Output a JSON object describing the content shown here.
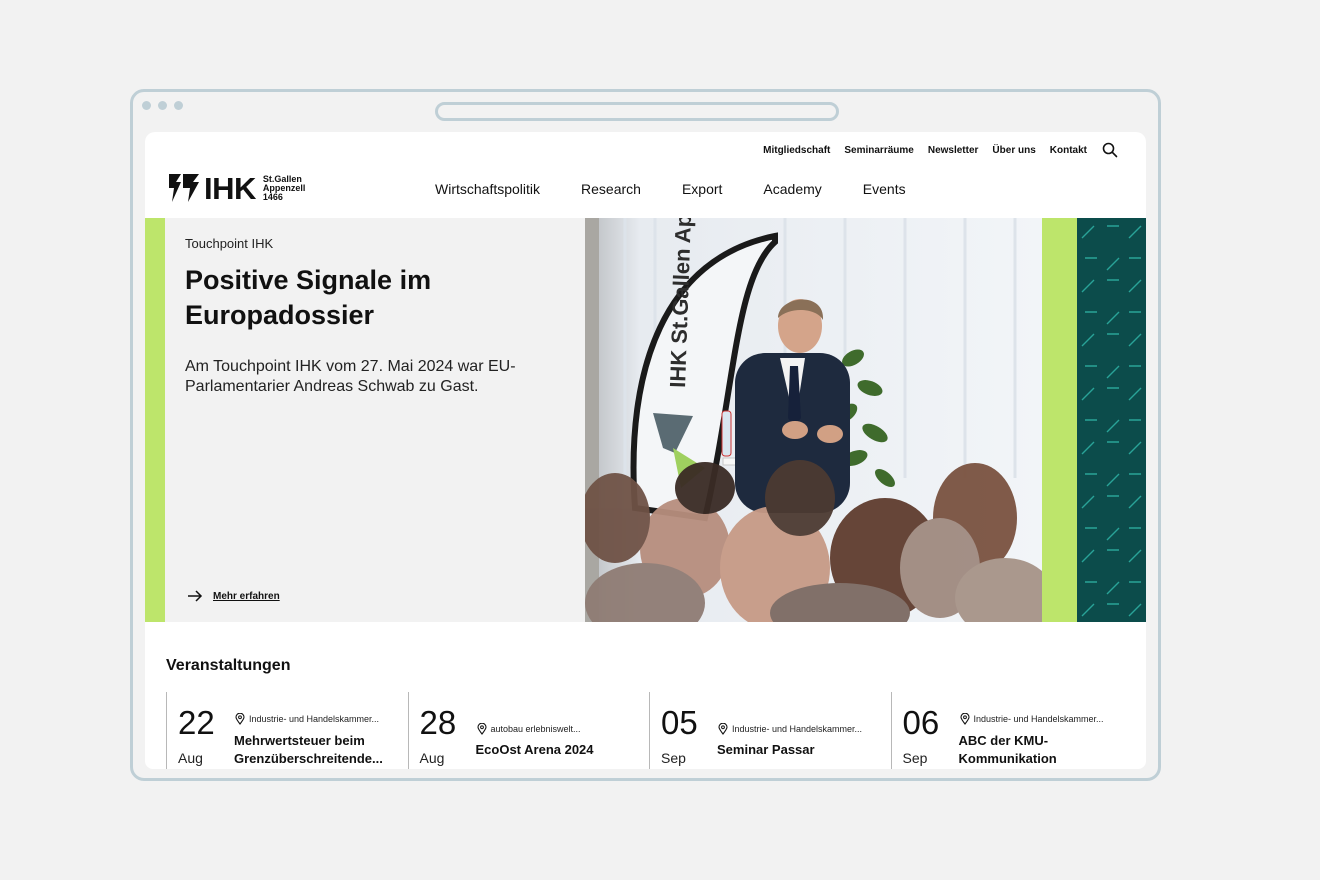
{
  "utility_nav": [
    "Mitgliedschaft",
    "Seminarräume",
    "Newsletter",
    "Über uns",
    "Kontakt"
  ],
  "logo": {
    "text": "IHK",
    "line1": "St.Gallen",
    "line2": "Appenzell",
    "line3": "1466"
  },
  "main_nav": [
    "Wirtschaftspolitik",
    "Research",
    "Export",
    "Academy",
    "Events"
  ],
  "hero": {
    "kicker": "Touchpoint IHK",
    "title": "Positive Signale im Europadossier",
    "lead": "Am Touchpoint IHK vom 27. Mai 2024 war EU-Parlamentarier Andreas Schwab zu Gast.",
    "link": "Mehr erfahren",
    "banner_text": "IHK St.Gallen Appenzell"
  },
  "events": {
    "title": "Veranstaltungen",
    "items": [
      {
        "day": "22",
        "month": "Aug",
        "location": "Industrie- und Handelskammer...",
        "title": "Mehrwertsteuer beim Grenzüberschreitende..."
      },
      {
        "day": "28",
        "month": "Aug",
        "location": "autobau erlebniswelt...",
        "title": "EcoOst Arena 2024"
      },
      {
        "day": "05",
        "month": "Sep",
        "location": "Industrie- und Handelskammer...",
        "title": "Seminar Passar"
      },
      {
        "day": "06",
        "month": "Sep",
        "location": "Industrie- und Handelskammer...",
        "title": "ABC der KMU-Kommunikation"
      }
    ]
  },
  "colors": {
    "accent_green": "#bde56b",
    "dark_teal": "#0c4c4b",
    "frame": "#bfcfd6"
  }
}
